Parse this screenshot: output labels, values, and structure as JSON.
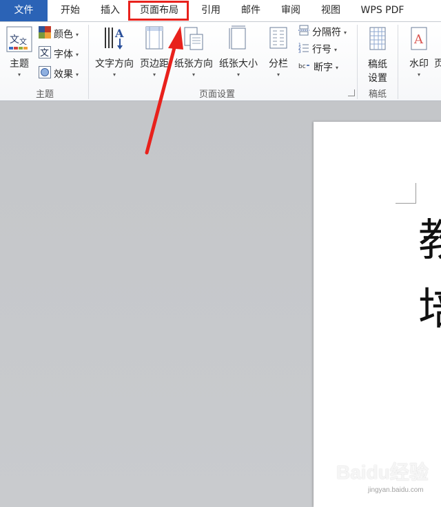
{
  "tabs": [
    {
      "label": "文件",
      "active": false
    },
    {
      "label": "开始"
    },
    {
      "label": "插入"
    },
    {
      "label": "页面布局",
      "active": true
    },
    {
      "label": "引用"
    },
    {
      "label": "邮件"
    },
    {
      "label": "审阅"
    },
    {
      "label": "视图"
    },
    {
      "label": "WPS PDF"
    }
  ],
  "ribbon": {
    "themes_group": {
      "theme_button": "主题",
      "colors": "颜色",
      "fonts": "字体",
      "effects": "效果",
      "label": "主题"
    },
    "page_setup_group": {
      "text_direction": "文字方向",
      "margins": "页边距",
      "orientation": "纸张方向",
      "size": "纸张大小",
      "columns": "分栏",
      "breaks": "分隔符",
      "line_numbers": "行号",
      "hyphenation": "断字",
      "label": "页面设置"
    },
    "draft_paper_group": {
      "button": "稿纸设置",
      "button_line1": "稿纸",
      "button_line2": "设置",
      "label": "稿纸"
    },
    "background_group": {
      "watermark": "水印",
      "page_color_partial": "页"
    }
  },
  "document": {
    "line1": "教",
    "line2": "培"
  },
  "watermark": {
    "brand": "Baidu经验",
    "url": "jingyan.baidu.com"
  },
  "colors": {
    "file_tab": "#2b63b6",
    "highlight": "#e8211c",
    "arrow": "#e8211c"
  }
}
